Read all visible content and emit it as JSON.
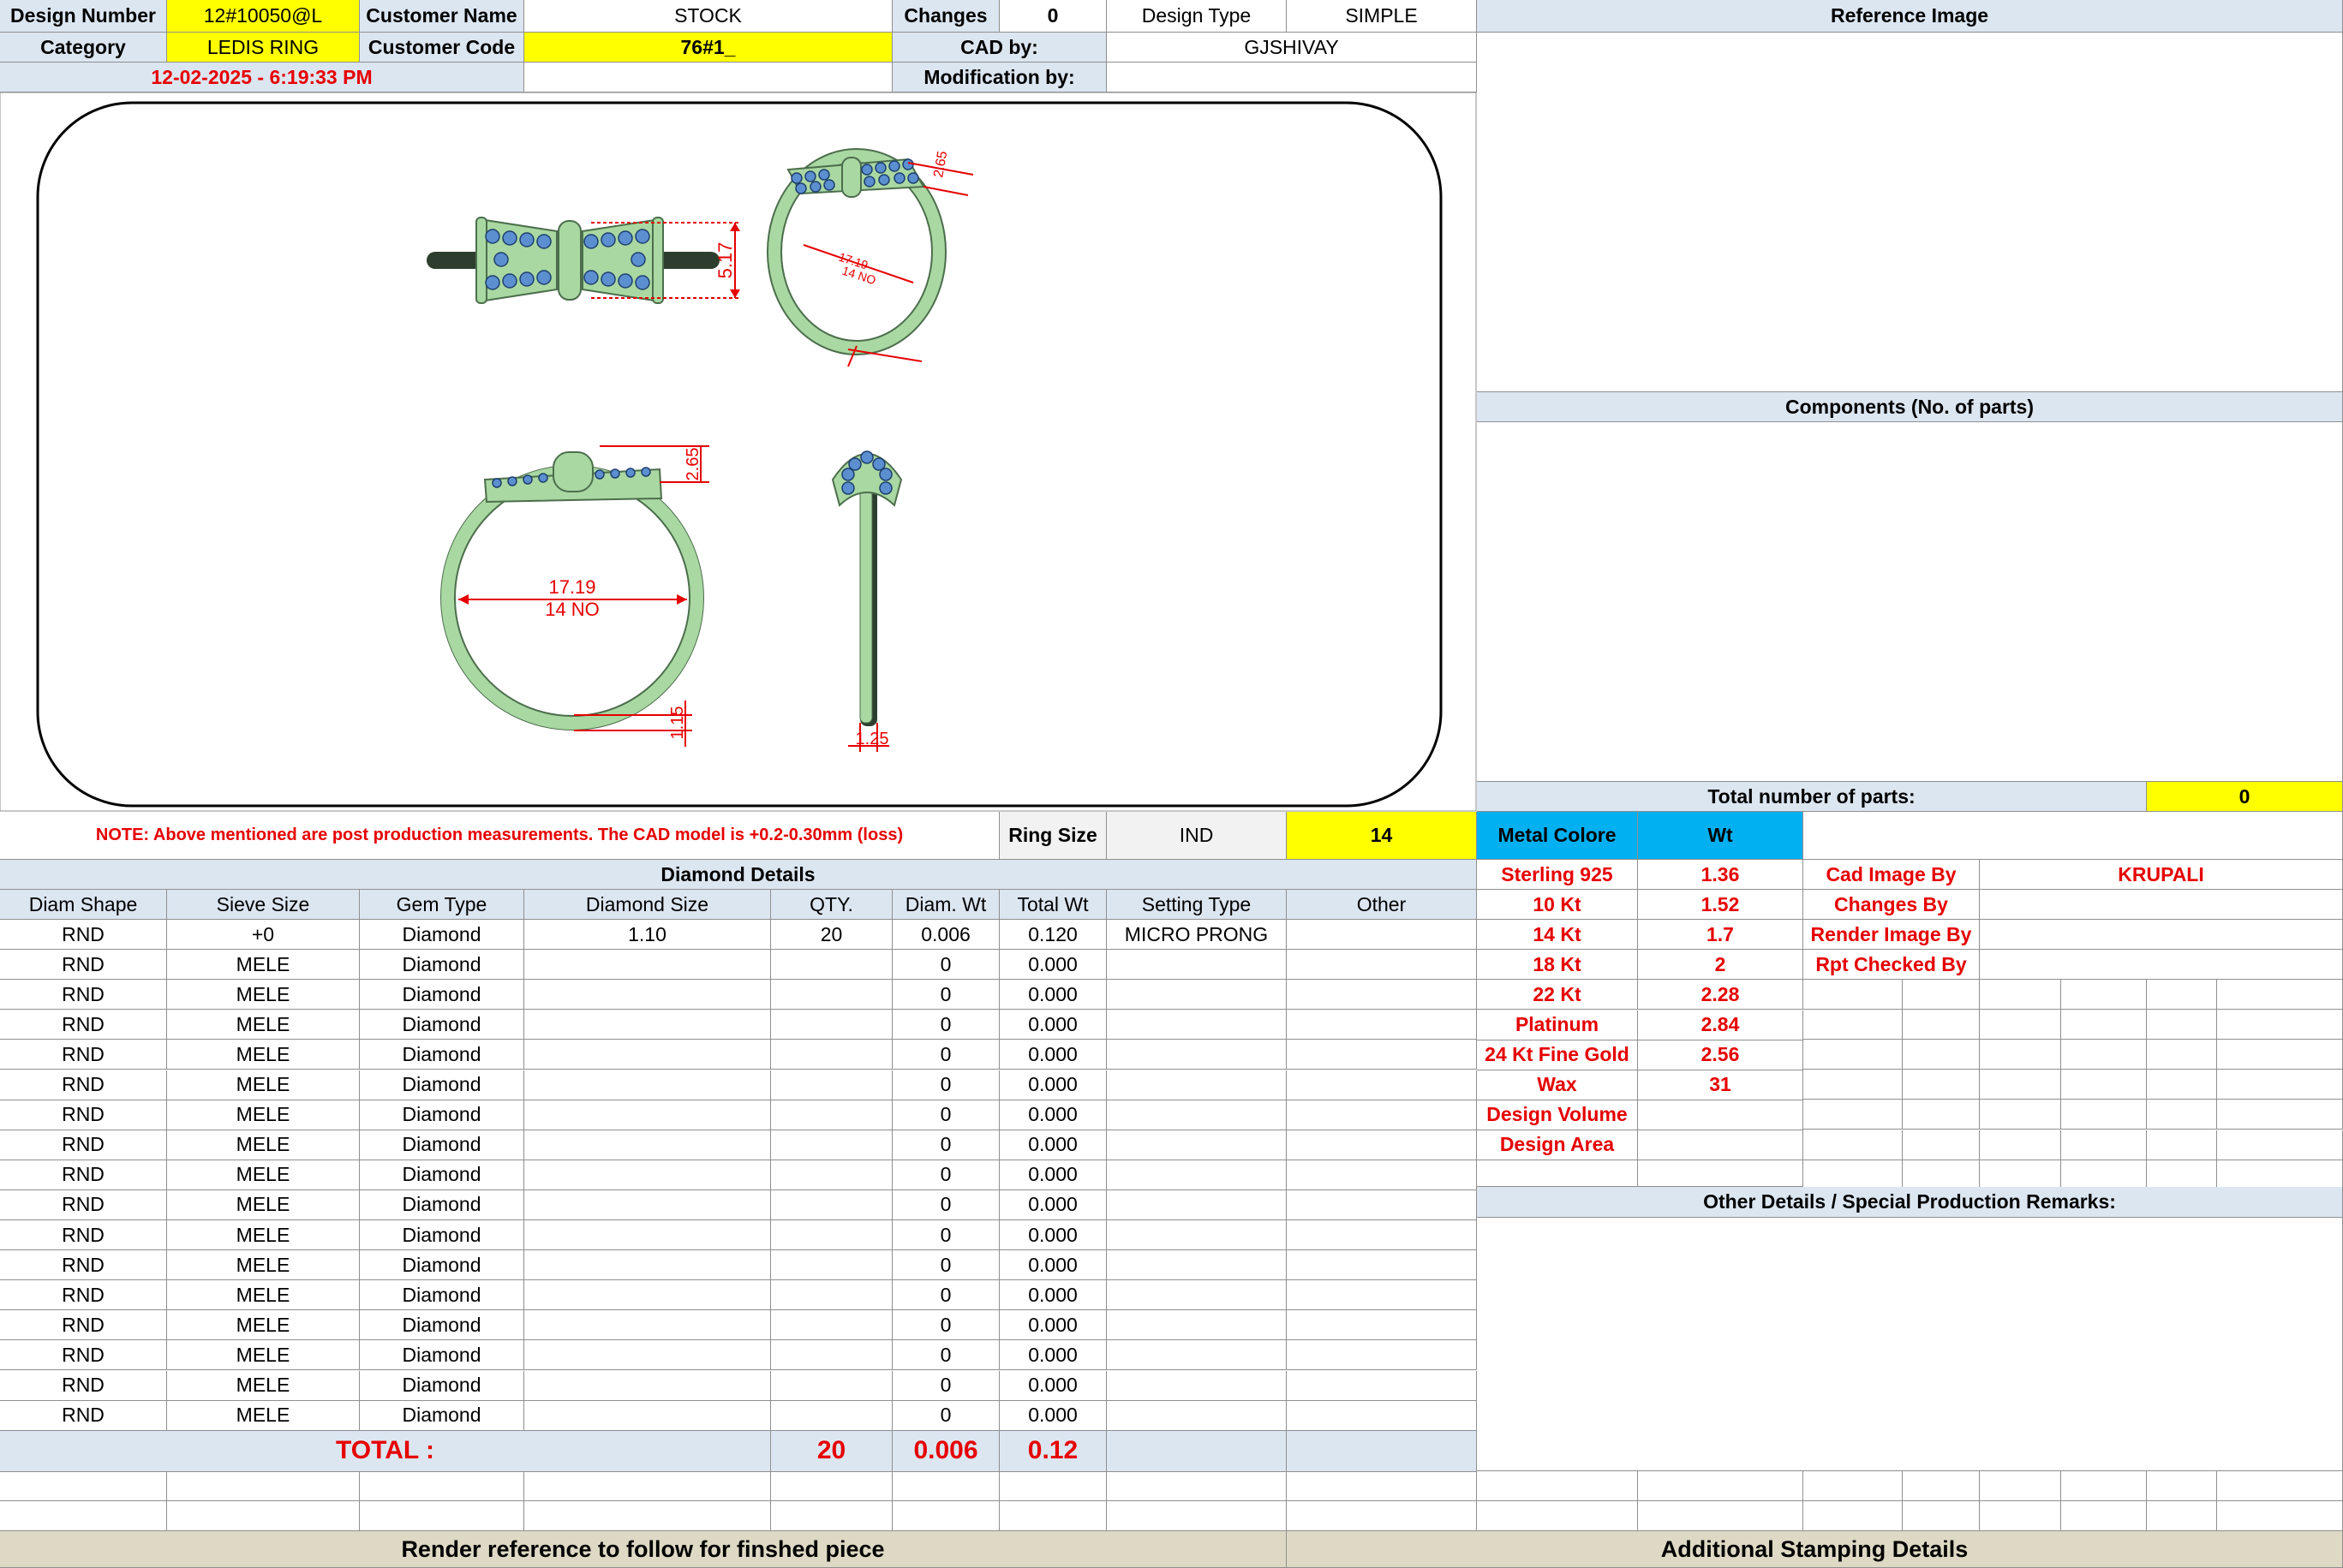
{
  "header": {
    "design_number_label": "Design Number",
    "design_number": "12#10050@L",
    "customer_name_label": "Customer Name",
    "customer_name": "STOCK",
    "changes_label": "Changes",
    "changes": "0",
    "design_type_label": "Design Type",
    "design_type": "SIMPLE",
    "reference_image_label": "Reference Image",
    "category_label": "Category",
    "category": "LEDIS RING",
    "customer_code_label": "Customer Code",
    "customer_code": "76#1_",
    "cad_by_label": "CAD by:",
    "cad_by": "GJSHIVAY",
    "datetime": "12-02-2025 - 6:19:33 PM",
    "modification_by_label": "Modification by:"
  },
  "drawing": {
    "dim_517": "5.17",
    "dim_265": "2.65",
    "dim_inner": "17.19",
    "dim_size": "14 NO",
    "dim_115": "1.15",
    "dim_125": "1.25",
    "metal_color": "#a9d8a2",
    "stone_color": "#5b8fd0",
    "dim_color": "#e60000"
  },
  "right_panel": {
    "components_label": "Components (No. of parts)",
    "total_parts_label": "Total number of parts:",
    "total_parts": "0"
  },
  "note_row": {
    "note": "NOTE: Above mentioned are post production measurements. The CAD model is +0.2-0.30mm (loss)",
    "ring_size_label": "Ring Size",
    "ring_size_std": "IND",
    "ring_size_value": "14",
    "metal_colore_label": "Metal Colore",
    "wt_label": "Wt"
  },
  "diamond": {
    "title": "Diamond Details",
    "headers": [
      "Diam Shape",
      "Sieve Size",
      "Gem Type",
      "Diamond Size",
      "QTY.",
      "Diam. Wt",
      "Total Wt",
      "Setting Type",
      "Other"
    ],
    "rows": [
      [
        "RND",
        "+0",
        "Diamond",
        "1.10",
        "20",
        "0.006",
        "0.120",
        "MICRO PRONG",
        ""
      ],
      [
        "RND",
        "MELE",
        "Diamond",
        "",
        "",
        "0",
        "0.000",
        "",
        ""
      ],
      [
        "RND",
        "MELE",
        "Diamond",
        "",
        "",
        "0",
        "0.000",
        "",
        ""
      ],
      [
        "RND",
        "MELE",
        "Diamond",
        "",
        "",
        "0",
        "0.000",
        "",
        ""
      ],
      [
        "RND",
        "MELE",
        "Diamond",
        "",
        "",
        "0",
        "0.000",
        "",
        ""
      ],
      [
        "RND",
        "MELE",
        "Diamond",
        "",
        "",
        "0",
        "0.000",
        "",
        ""
      ],
      [
        "RND",
        "MELE",
        "Diamond",
        "",
        "",
        "0",
        "0.000",
        "",
        ""
      ],
      [
        "RND",
        "MELE",
        "Diamond",
        "",
        "",
        "0",
        "0.000",
        "",
        ""
      ],
      [
        "RND",
        "MELE",
        "Diamond",
        "",
        "",
        "0",
        "0.000",
        "",
        ""
      ],
      [
        "RND",
        "MELE",
        "Diamond",
        "",
        "",
        "0",
        "0.000",
        "",
        ""
      ],
      [
        "RND",
        "MELE",
        "Diamond",
        "",
        "",
        "0",
        "0.000",
        "",
        ""
      ],
      [
        "RND",
        "MELE",
        "Diamond",
        "",
        "",
        "0",
        "0.000",
        "",
        ""
      ],
      [
        "RND",
        "MELE",
        "Diamond",
        "",
        "",
        "0",
        "0.000",
        "",
        ""
      ],
      [
        "RND",
        "MELE",
        "Diamond",
        "",
        "",
        "0",
        "0.000",
        "",
        ""
      ],
      [
        "RND",
        "MELE",
        "Diamond",
        "",
        "",
        "0",
        "0.000",
        "",
        ""
      ],
      [
        "RND",
        "MELE",
        "Diamond",
        "",
        "",
        "0",
        "0.000",
        "",
        ""
      ],
      [
        "RND",
        "MELE",
        "Diamond",
        "",
        "",
        "0",
        "0.000",
        "",
        ""
      ]
    ],
    "total_label": "TOTAL :",
    "total_qty": "20",
    "total_diam_wt": "0.006",
    "total_wt": "0.12"
  },
  "metal": [
    {
      "name": "Sterling 925",
      "wt": "1.36"
    },
    {
      "name": "10 Kt",
      "wt": "1.52"
    },
    {
      "name": "14 Kt",
      "wt": "1.7"
    },
    {
      "name": "18 Kt",
      "wt": "2"
    },
    {
      "name": "22 Kt",
      "wt": "2.28"
    },
    {
      "name": "Platinum",
      "wt": "2.84"
    },
    {
      "name": "24 Kt Fine Gold",
      "wt": "2.56"
    },
    {
      "name": "Wax",
      "wt": "31"
    },
    {
      "name": "Design Volume",
      "wt": ""
    },
    {
      "name": "Design Area",
      "wt": ""
    }
  ],
  "credits": [
    {
      "label": "Cad Image By",
      "value": "KRUPALI"
    },
    {
      "label": "Changes By",
      "value": ""
    },
    {
      "label": "Render Image By",
      "value": ""
    },
    {
      "label": "Rpt Checked By",
      "value": ""
    }
  ],
  "other_details_label": "Other Details / Special Production Remarks:",
  "footer": {
    "render_ref": "Render reference to follow for finshed piece",
    "stamping": "Additional Stamping Details"
  }
}
